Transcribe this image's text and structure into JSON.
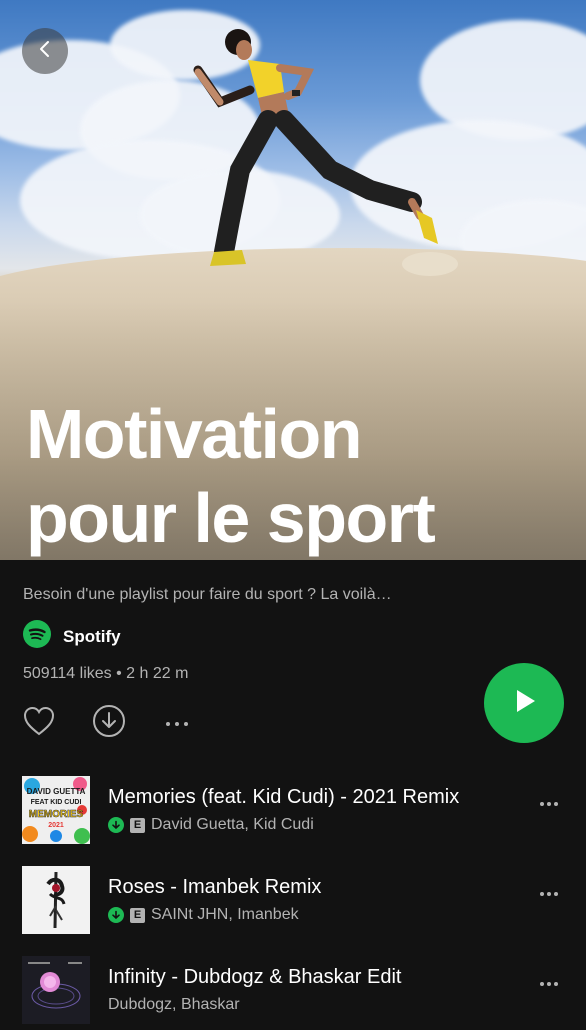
{
  "header": {
    "title_line1": "Motivation",
    "title_line2": "pour le sport"
  },
  "playlist": {
    "description": "Besoin d'une playlist pour faire du sport ? La voilà…",
    "owner": "Spotify",
    "meta": "509114 likes • 2 h 22 m"
  },
  "icons": {
    "back": "chevron-left-icon",
    "like": "heart-icon",
    "download": "download-icon",
    "more": "more-horizontal-icon",
    "play": "play-icon",
    "spotify": "spotify-logo"
  },
  "colors": {
    "background": "#121212",
    "accent_green": "#1db954",
    "secondary_text": "#b3b3b3"
  },
  "tracks": [
    {
      "title": "Memories (feat. Kid Cudi) - 2021 Remix",
      "artists": "David Guetta, Kid Cudi",
      "downloaded": true,
      "explicit": true,
      "cover_text": [
        "DAVID GUETTA",
        "FEAT KID CUDI",
        "MEMORIES",
        "2021"
      ]
    },
    {
      "title": "Roses - Imanbek Remix",
      "artists": "SAINt JHN, Imanbek",
      "downloaded": true,
      "explicit": true
    },
    {
      "title": "Infinity - Dubdogz & Bhaskar Edit",
      "artists": "Dubdogz, Bhaskar",
      "downloaded": false,
      "explicit": false
    }
  ],
  "labels": {
    "explicit": "E"
  }
}
